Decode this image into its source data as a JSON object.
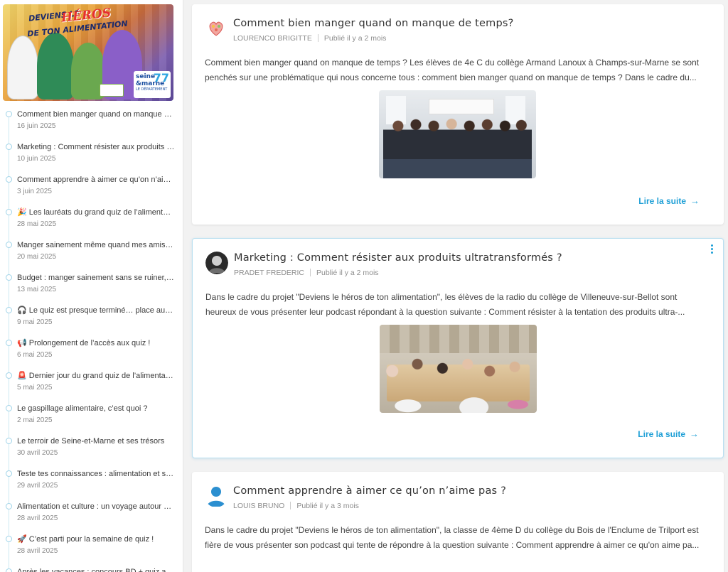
{
  "sidebar": {
    "banner": {
      "title_line1": "DEVIENS LE",
      "title_hero": "HÉROS",
      "title_line2": "DE TON ALIMENTATION",
      "logo_line1": "seine",
      "logo_line2": "&marne",
      "logo_line3": "LE DÉPARTEMENT",
      "logo_number": "77"
    },
    "items": [
      {
        "title": "Comment bien manger quand on manque de temps?",
        "date": "16 juin 2025"
      },
      {
        "title": "Marketing : Comment résister aux produits ultratransformés ?",
        "date": "10 juin 2025"
      },
      {
        "title": "Comment apprendre à aimer ce qu’on n’aime pas ?",
        "date": "3 juin 2025"
      },
      {
        "title": "🎉 Les lauréats du grand quiz de l’alimentation",
        "date": "28 mai 2025"
      },
      {
        "title": "Manger sainement même quand mes amis ne le font pas",
        "date": "20 mai 2025"
      },
      {
        "title": "Budget : manger sainement sans se ruiner, est-ce possible ?",
        "date": "13 mai 2025"
      },
      {
        "title": "🎧 Le quiz est presque terminé… place au podcast",
        "date": "9 mai 2025"
      },
      {
        "title": "📢 Prolongement de l’accès aux quiz !",
        "date": "6 mai 2025"
      },
      {
        "title": "🚨 Dernier jour du grand quiz de l’alimentation",
        "date": "5 mai 2025"
      },
      {
        "title": "Le gaspillage alimentaire, c’est quoi ?",
        "date": "2 mai 2025"
      },
      {
        "title": "Le terroir de Seine-et-Marne et ses trésors",
        "date": "30 avril 2025"
      },
      {
        "title": "Teste tes connaissances : alimentation et santé",
        "date": "29 avril 2025"
      },
      {
        "title": "Alimentation et culture : un voyage autour du monde",
        "date": "28 avril 2025"
      },
      {
        "title": "🚀 C’est parti pour la semaine de quiz !",
        "date": "28 avril 2025"
      },
      {
        "title": "Après les vacances : concours BD + quiz alimentation",
        "date": ""
      }
    ]
  },
  "posts": [
    {
      "title": "Comment bien manger quand on manque de temps?",
      "author": "LOURENCO BRIGITTE",
      "published": "Publié il y a 2 mois",
      "excerpt_line1": "Comment bien manger quand on manque de temps ? Les élèves de 4e C du collège Armand Lanoux à Champs-sur-Marne se sont",
      "excerpt_line2": "penchés sur une problématique qui nous concerne tous : comment bien manger quand on manque de temps ? Dans le cadre du...",
      "read_more": "Lire la suite",
      "avatar_icon": "heart-flower-icon"
    },
    {
      "title": "Marketing : Comment résister aux produits ultratransformés ?",
      "author": "PRADET FREDERIC",
      "published": "Publié il y a 2 mois",
      "excerpt_line1": "Dans le cadre du projet \"Deviens le héros de ton alimentation\", les élèves de la radio du collège de Villeneuve-sur-Bellot sont",
      "excerpt_line2": "heureux de vous présenter leur podcast répondant à la question suivante : Comment résister à la tentation des produits ultra-...",
      "read_more": "Lire la suite",
      "avatar_icon": "profile-photo"
    },
    {
      "title": "Comment apprendre à aimer ce qu’on n’aime pas ?",
      "author": "LOUIS BRUNO",
      "published": "Publié il y a 3 mois",
      "excerpt_line1": "Dans le cadre du projet \"Deviens le héros de ton alimentation\", la classe de 4ème D du collège du Bois de l'Enclume de Trilport est",
      "excerpt_line2": "fière de vous présenter son podcast qui tente de répondre à la question suivante : Comment apprendre à aimer ce qu'on aime pa...",
      "avatar_icon": "default-user-icon"
    }
  ],
  "colors": {
    "accent": "#1e9fd6",
    "timeline": "#9fd3e8"
  }
}
